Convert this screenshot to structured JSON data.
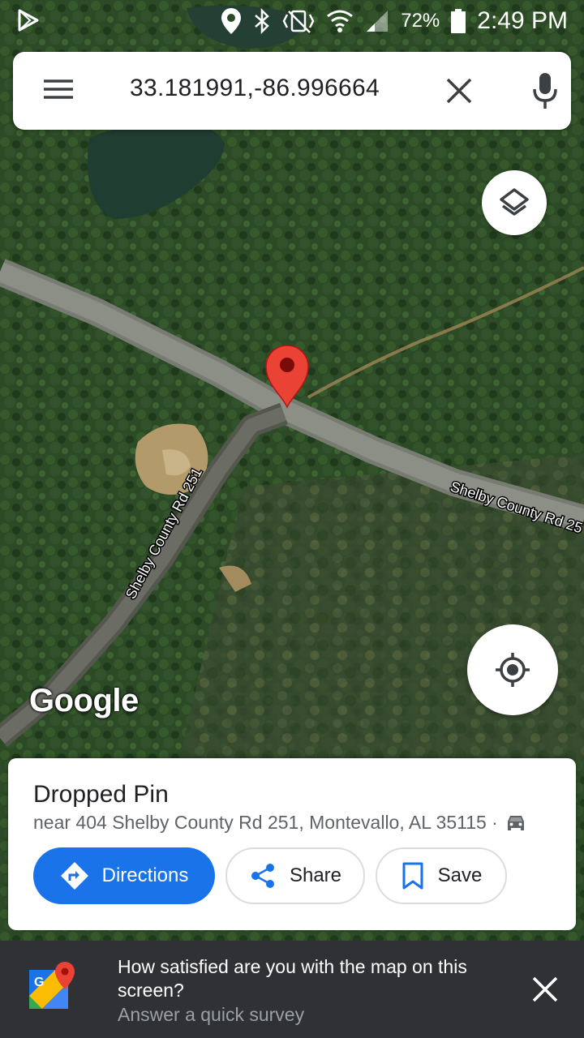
{
  "status_bar": {
    "battery_percent": "72%",
    "time": "2:49 PM"
  },
  "search": {
    "query": "33.181991,-86.996664"
  },
  "map": {
    "road_label_east": "Shelby County Rd 25",
    "road_label_south": "Shelby County Rd 251",
    "attribution": "Google",
    "pin_color": "#ea4335"
  },
  "place_card": {
    "title": "Dropped Pin",
    "address": "near 404 Shelby County Rd 251, Montevallo, AL 35115 ·",
    "buttons": {
      "directions": "Directions",
      "share": "Share",
      "save": "Save"
    },
    "accent": "#1a73e8"
  },
  "survey": {
    "question": "How satisfied are you with the map on this screen?",
    "action": "Answer a quick survey"
  },
  "icons": [
    "play-store-icon",
    "location-icon",
    "bluetooth-icon",
    "vibrate-icon",
    "wifi-icon",
    "signal-icon",
    "battery-icon",
    "menu-icon",
    "close-icon",
    "mic-icon",
    "layers-icon",
    "my-location-icon",
    "car-icon",
    "directions-icon",
    "share-icon",
    "bookmark-icon",
    "google-maps-logo-icon"
  ]
}
